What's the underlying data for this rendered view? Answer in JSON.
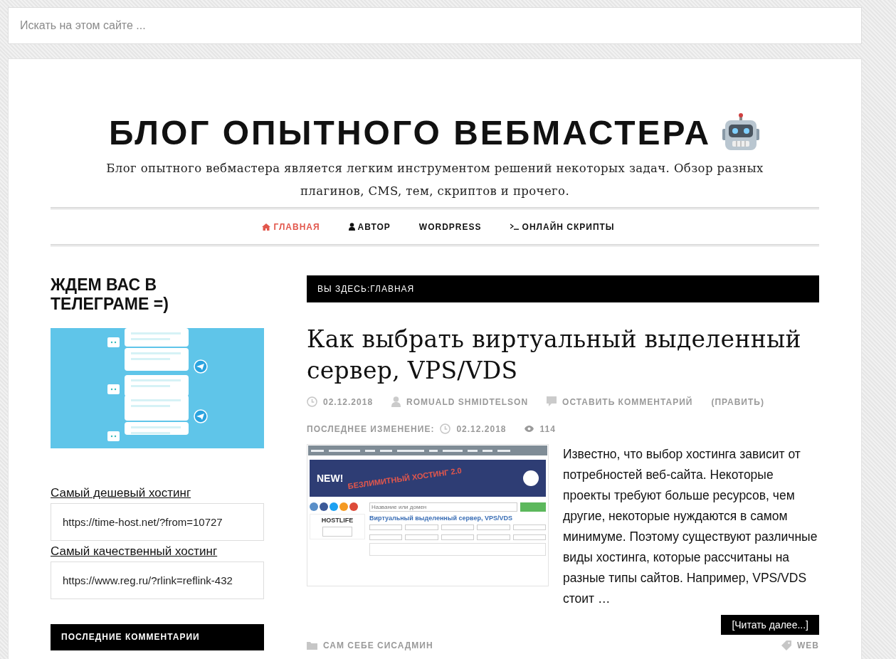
{
  "search": {
    "placeholder": "Искать на этом сайте ..."
  },
  "header": {
    "title": "БЛОГ ОПЫТНОГО ВЕБМАСТЕРА",
    "tagline": "Блог опытного вебмастера является легким инструментом решений некоторых задач. Обзор разных плагинов, CMS, тем, скриптов и прочего."
  },
  "nav": [
    {
      "label": "ГЛАВНАЯ",
      "selected": true
    },
    {
      "label": "АВТОР",
      "selected": false
    },
    {
      "label": "WORDPRESS",
      "selected": false
    },
    {
      "label": "ОНЛАЙН СКРИПТЫ",
      "selected": false
    }
  ],
  "sidebar": {
    "telegram_title": "ЖДЕМ ВАС В ТЕЛЕГРАМЕ =)",
    "links": [
      {
        "label": "Самый дешевый хостинг",
        "value": "https://time-host.net/?from=10727"
      },
      {
        "label": "Самый качественный хостинг",
        "value": "https://www.reg.ru/?rlink=reflink-432"
      }
    ],
    "comments_title": "ПОСЛЕДНИЕ КОММЕНТАРИИ"
  },
  "breadcrumb": {
    "prefix": "ВЫ ЗДЕСЬ:",
    "current": "ГЛАВНАЯ"
  },
  "post": {
    "title": "Как выбрать виртуальный выделенный сервер, VPS/VDS",
    "date": "02.12.2018",
    "author": "ROMUALD SHMIDTELSON",
    "comment": "ОСТАВИТЬ КОММЕНТАРИЙ",
    "edit": "(ПРАВИТЬ)",
    "modified_label": "ПОСЛЕДНЕЕ ИЗМЕНЕНИЕ:",
    "modified_date": "02.12.2018",
    "views": "114",
    "excerpt": "Известно, что выбор хостинга зависит от потребностей веб-сайта. Некоторые проекты требуют больше ресурсов, чем другие, некоторые нуждаются в самом минимуме. Поэтому существуют различные виды хостинга, которые рассчитаны на разные типы сайтов. Например, VPS/VDS стоит …",
    "read_more": "[Читать далее...]",
    "category": "САМ СЕБЕ СИСАДМИН",
    "tag": "WEB",
    "thumbnail": {
      "banner_new": "NEW!",
      "banner_title": "БЕЗЛИМИТНЫЙ ХОСТИНГ 2.0",
      "search_placeholder": "Название или домен",
      "heading": "Виртуальный выделенный сервер, VPS/VDS",
      "box_logo": "HOSTLIFE"
    }
  }
}
